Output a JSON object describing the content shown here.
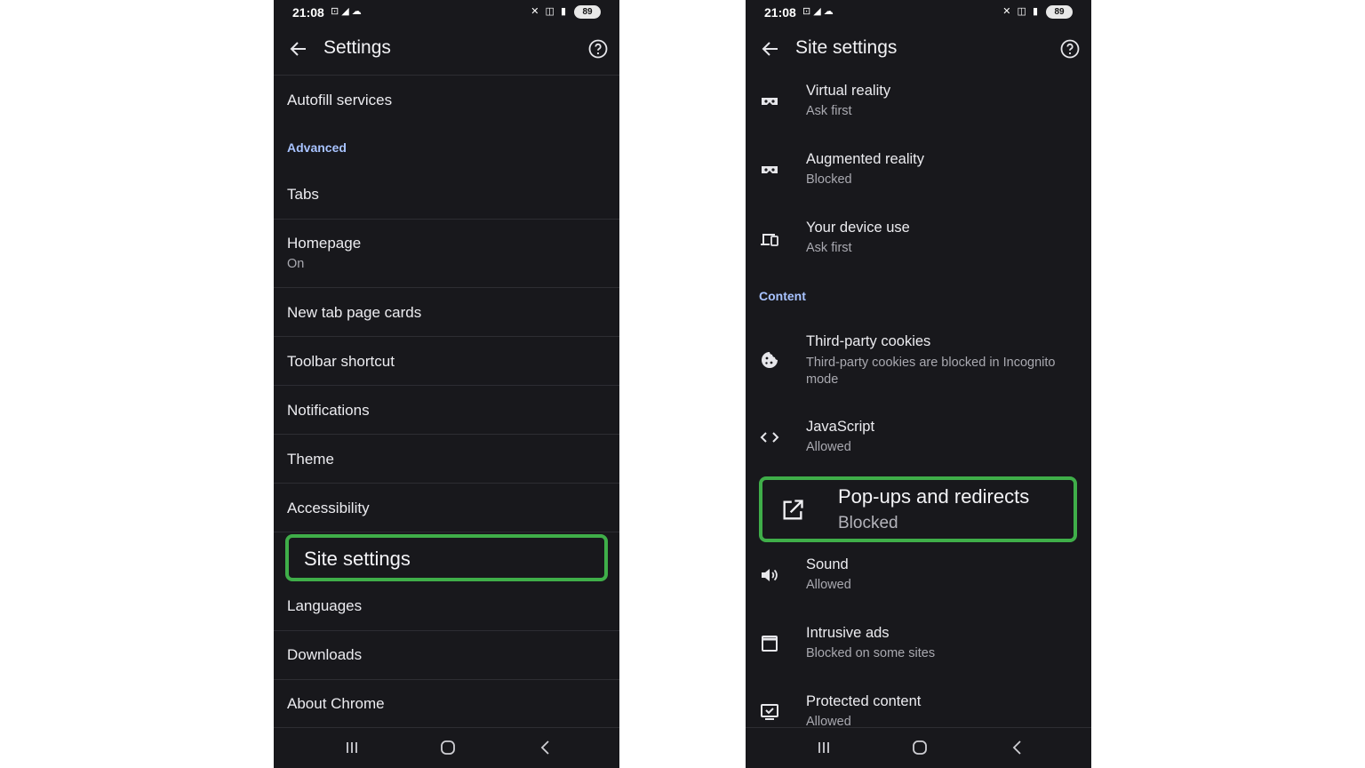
{
  "left_screen": {
    "status": {
      "time": "21:08",
      "battery": "89"
    },
    "title": "Settings",
    "items": {
      "autofill": "Autofill services",
      "advanced_header": "Advanced",
      "tabs": "Tabs",
      "homepage": "Homepage",
      "homepage_sub": "On",
      "new_tab_cards": "New tab page cards",
      "toolbar_shortcut": "Toolbar shortcut",
      "notifications": "Notifications",
      "theme": "Theme",
      "accessibility": "Accessibility",
      "site_settings": "Site settings",
      "languages": "Languages",
      "downloads": "Downloads",
      "about_chrome": "About Chrome"
    }
  },
  "right_screen": {
    "status": {
      "time": "21:08",
      "battery": "89"
    },
    "title": "Site settings",
    "content_header": "Content",
    "items": [
      {
        "title": "Virtual reality",
        "subtitle": "Ask first",
        "icon": "vr-headset-icon"
      },
      {
        "title": "Augmented reality",
        "subtitle": "Blocked",
        "icon": "ar-headset-icon"
      },
      {
        "title": "Your device use",
        "subtitle": "Ask first",
        "icon": "devices-icon"
      },
      {
        "title": "Third-party cookies",
        "subtitle": "Third-party cookies are blocked in Incognito mode",
        "icon": "cookie-icon"
      },
      {
        "title": "JavaScript",
        "subtitle": "Allowed",
        "icon": "code-icon"
      },
      {
        "title": "Pop-ups and redirects",
        "subtitle": "Blocked",
        "icon": "open-external-icon"
      },
      {
        "title": "Sound",
        "subtitle": "Allowed",
        "icon": "speaker-icon"
      },
      {
        "title": "Intrusive ads",
        "subtitle": "Blocked on some sites",
        "icon": "window-icon"
      },
      {
        "title": "Protected content",
        "subtitle": "Allowed",
        "icon": "protected-content-icon"
      }
    ]
  },
  "colors": {
    "highlight": "#3fae49",
    "accent": "#a8c3ff",
    "background": "#18181c"
  }
}
